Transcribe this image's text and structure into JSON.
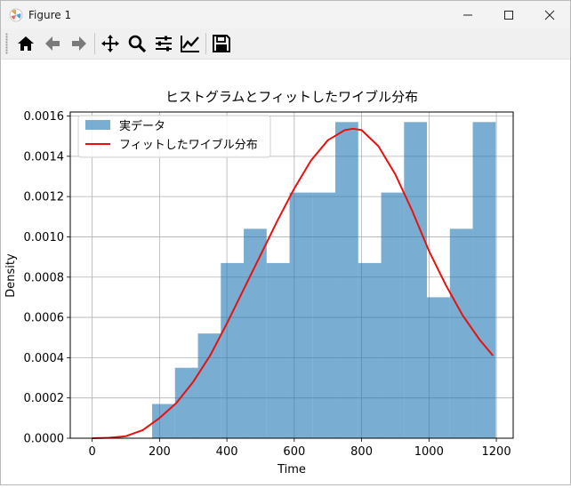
{
  "window": {
    "title": "Figure 1"
  },
  "toolbar": {
    "buttons": [
      "home-icon",
      "back-icon",
      "forward-icon",
      "pan-icon",
      "zoom-icon",
      "configure-icon",
      "edit-axes-icon",
      "save-icon"
    ]
  },
  "colors": {
    "bars": "#1f77b4",
    "bar_alpha": 0.6,
    "fit_line": "#e8110f",
    "grid": "#b0b0b0"
  },
  "chart_data": {
    "type": "bar",
    "title": "ヒストグラムとフィットしたワイブル分布",
    "xlabel": "Time",
    "ylabel": "Density",
    "xlim": [
      -65,
      1250
    ],
    "ylim": [
      0,
      0.00162
    ],
    "x_ticks": [
      "0",
      "200",
      "400",
      "600",
      "800",
      "1000",
      "1200"
    ],
    "y_ticks": [
      "0.0000",
      "0.0002",
      "0.0004",
      "0.0006",
      "0.0008",
      "0.0010",
      "0.0012",
      "0.0014",
      "0.0016"
    ],
    "grid": true,
    "legend": {
      "position": "top-left",
      "entries": [
        "実データ",
        "フィットしたワイブル分布"
      ]
    },
    "histogram": {
      "name": "実データ",
      "bin_edges": [
        178,
        246,
        314,
        382,
        450,
        518,
        586,
        654,
        722,
        790,
        858,
        926,
        994,
        1062,
        1130,
        1198
      ],
      "values": [
        0.00017,
        0.00035,
        0.00052,
        0.00087,
        0.00104,
        0.00087,
        0.00122,
        0.00122,
        0.00157,
        0.00087,
        0.00122,
        0.00157,
        0.0007,
        0.00104,
        0.00157
      ]
    },
    "series": [
      {
        "name": "フィットしたワイブル分布",
        "type": "line",
        "x": [
          0,
          50,
          100,
          150,
          200,
          250,
          300,
          350,
          400,
          450,
          500,
          550,
          600,
          650,
          700,
          750,
          775,
          800,
          850,
          900,
          950,
          1000,
          1050,
          1100,
          1150,
          1190
        ],
        "y": [
          0,
          2e-06,
          1e-05,
          4e-05,
          0.0001,
          0.000175,
          0.00028,
          0.00041,
          0.00057,
          0.00074,
          0.00091,
          0.00108,
          0.00124,
          0.00138,
          0.00148,
          0.00153,
          0.001537,
          0.00153,
          0.00145,
          0.00131,
          0.00113,
          0.00093,
          0.00076,
          0.00061,
          0.00049,
          0.00041
        ]
      }
    ]
  }
}
